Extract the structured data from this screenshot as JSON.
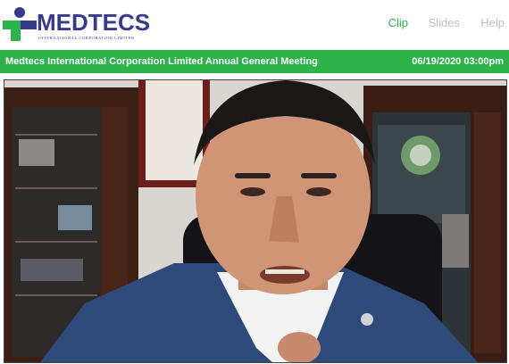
{
  "header": {
    "logo": {
      "name": "MEDTECS",
      "tagline": "INTERNATIONAL CORPORATION LIMITED",
      "brand_color": "#3a3a8c",
      "accent_green": "#2db34a"
    },
    "nav": [
      {
        "label": "Clip",
        "active": true
      },
      {
        "label": "Slides",
        "active": false
      },
      {
        "label": "Help",
        "active": false
      }
    ]
  },
  "title_bar": {
    "meeting_title": "Medtecs International Corporation Limited Annual General Meeting",
    "datetime": "06/19/2020 03:00pm",
    "color": "#2db34a"
  },
  "video": {
    "icon": "webcam-video-feed"
  }
}
